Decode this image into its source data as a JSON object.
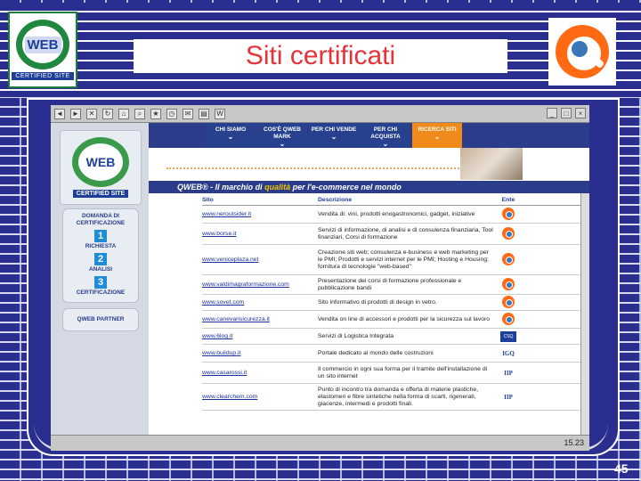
{
  "slide": {
    "title": "Siti certificati",
    "page_number": "45",
    "left_logo": {
      "word": "WEB",
      "caption": "CERTIFIED SITE"
    }
  },
  "browser": {
    "clock": "15.23"
  },
  "site": {
    "logo_word": "WEB",
    "logo_caption": "CERTIFIED SITE",
    "nav": [
      {
        "label": "CHI SIAMO",
        "active": false
      },
      {
        "label": "COS'È QWEB MARK",
        "active": false
      },
      {
        "label": "PER CHI VENDE",
        "active": false
      },
      {
        "label": "PER CHI ACQUISTA",
        "active": false
      },
      {
        "label": "RICERCA SITI",
        "active": true
      }
    ],
    "cert_box": {
      "heading": "DOMANDA DI CERTIFICAZIONE",
      "steps": [
        {
          "num": "1",
          "label": "RICHIESTA"
        },
        {
          "num": "2",
          "label": "ANALISI"
        },
        {
          "num": "3",
          "label": "CERTIFICAZIONE"
        }
      ]
    },
    "partner": "QWEB PARTNER",
    "banner_prefix": "QWEB® - Il marchio di ",
    "banner_highlight": "qualità",
    "banner_suffix": " per l'e-commerce nel mondo",
    "table": {
      "headers": {
        "sito": "Sito",
        "descrizione": "Descrizione",
        "ente": "Ente"
      },
      "rows": [
        {
          "sito": "www.neroutsider.it",
          "descrizione": "Vendita di: vini, prodotti enogastronomici, gadget, iniziative",
          "ente": "q"
        },
        {
          "sito": "www.borse.it",
          "descrizione": "Servizi di informazione, di analisi e di consulenza finanziaria, Tool finanziari, Corsi di formazione",
          "ente": "q"
        },
        {
          "sito": "www.veniceplaza.net",
          "descrizione": "Creazione siti web; consulenza e-business e web marketing per le PMI; Prodotti e servizi internet per le PMI; Hosting e Housing; fornitura di tecnologie \"web-based\"",
          "ente": "q"
        },
        {
          "sito": "www.valdimagraformazione.com",
          "descrizione": "Presentazione dei corsi di formazione professionale e pubblicazione bandi",
          "ente": "q"
        },
        {
          "sito": "www.sovet.com",
          "descrizione": "Sito informativo di prodotti di design in vetro.",
          "ente": "q"
        },
        {
          "sito": "www.canevarisicurezza.it",
          "descrizione": "Vendita on line di accessori e prodotti per la sicurezza sul lavoro",
          "ente": "q"
        },
        {
          "sito": "www.6log.it",
          "descrizione": "Servizi di Logistica Integrata",
          "ente": "CSQ"
        },
        {
          "sito": "www.buildup.it",
          "descrizione": "Portale dedicato al mondo delle costruzioni",
          "ente": "IGQ"
        },
        {
          "sito": "www.casarossi.it",
          "descrizione": "Il commercio in ogni sua forma per il tramite dell'installazione di un sito internet",
          "ente": "IIP"
        },
        {
          "sito": "www.clearchem.com",
          "descrizione": "Punto di incontro tra domanda e offerta di materie plastiche, elastomeri e fibre sintetiche nella forma di scarti, rigenerati, giacenze, intermedi e prodotti finali.",
          "ente": "IIP"
        }
      ]
    }
  }
}
